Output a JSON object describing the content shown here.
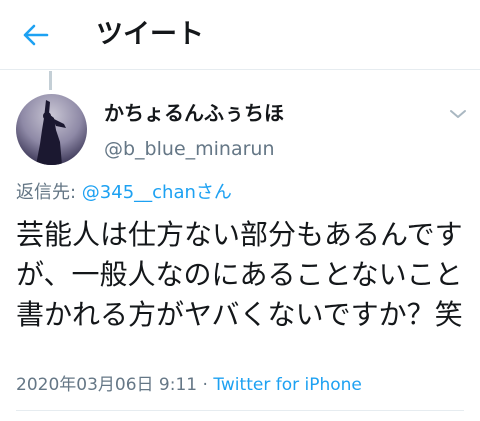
{
  "header": {
    "title": "ツイート",
    "back_icon": "arrow-left-icon",
    "accent_color": "#1da1f2"
  },
  "tweet": {
    "author": {
      "display_name": "かちょるんふぅちほ",
      "handle": "@b_blue_minarun",
      "avatar_icon": "profile-avatar"
    },
    "menu_icon": "chevron-down-icon",
    "reply_prefix": "返信先: ",
    "reply_mention": "@345__chanさん",
    "text": "芸能人は仕方ない部分もあるんですが、一般人なのにあることないこと書かれる方がヤバくないですか？笑",
    "timestamp": "2020年03月06日 9:11",
    "separator": " · ",
    "source": "Twitter for iPhone"
  }
}
